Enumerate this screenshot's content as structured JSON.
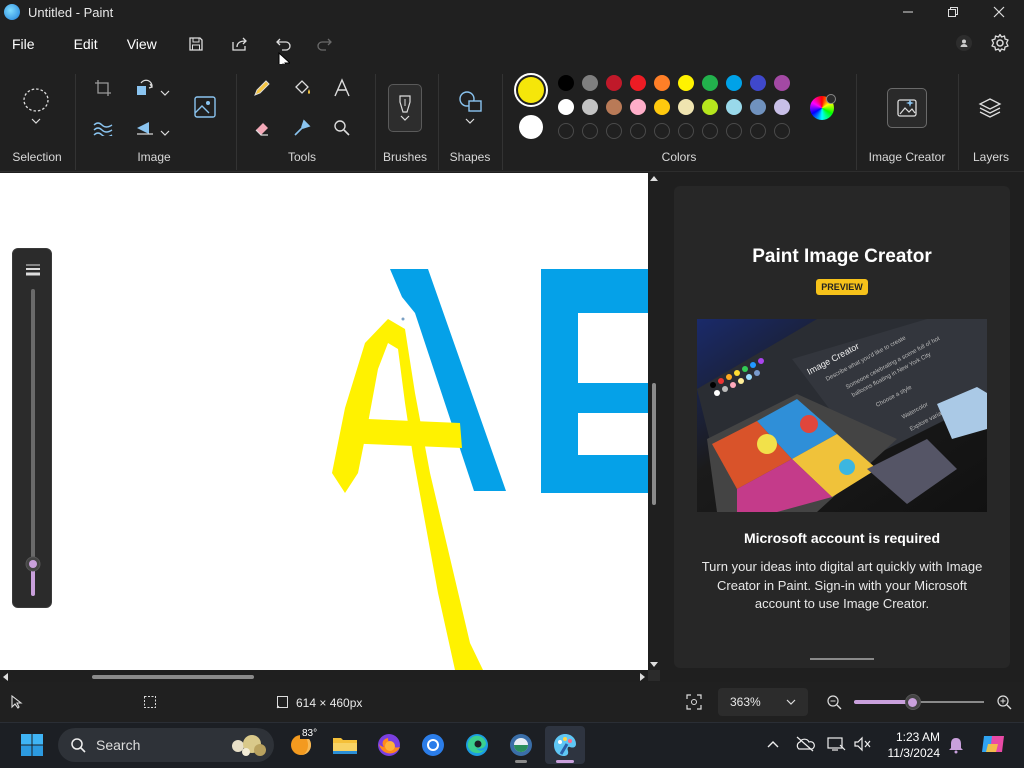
{
  "window": {
    "title": "Untitled - Paint"
  },
  "menu": {
    "file": "File",
    "edit": "Edit",
    "view": "View"
  },
  "ribbon": {
    "selection": "Selection",
    "image": "Image",
    "tools": "Tools",
    "brushes": "Brushes",
    "shapes": "Shapes",
    "colors": "Colors",
    "image_creator": "Image Creator",
    "layers": "Layers"
  },
  "palette": {
    "primary": "#f5e60a",
    "secondary": "#ffffff",
    "row1": [
      "#000000",
      "#7f7f7f",
      "#c0192a",
      "#ed1c24",
      "#ff7f27",
      "#fff200",
      "#22b14c",
      "#00a2e8",
      "#3f48cc",
      "#a349a4"
    ],
    "row2": [
      "#ffffff",
      "#c3c3c3",
      "#b97a57",
      "#ffaec9",
      "#ffc90e",
      "#efe4b0",
      "#b5e61d",
      "#99d9ea",
      "#7092be",
      "#c8bfe7"
    ]
  },
  "panel": {
    "title": "Paint Image Creator",
    "badge": "PREVIEW",
    "image_caption": "Image Creator",
    "image_lines": [
      "Describe what you'd like to create",
      "Someone celebrating a scene full of hot",
      "balloons floating in New York City",
      "Choose a style",
      "Watercolor",
      "Explore variants"
    ],
    "subtitle": "Microsoft account is required",
    "body": "Turn your ideas into digital art quickly with Image Creator in Paint. Sign-in with your Microsoft account to use Image Creator."
  },
  "status": {
    "canvas_size": "614 × 460px",
    "zoom": "363%",
    "zoom_slider_fraction": 0.45
  },
  "taskbar": {
    "search_placeholder": "Search",
    "weather": "83°",
    "time": "1:23 AM",
    "date": "11/3/2024"
  }
}
